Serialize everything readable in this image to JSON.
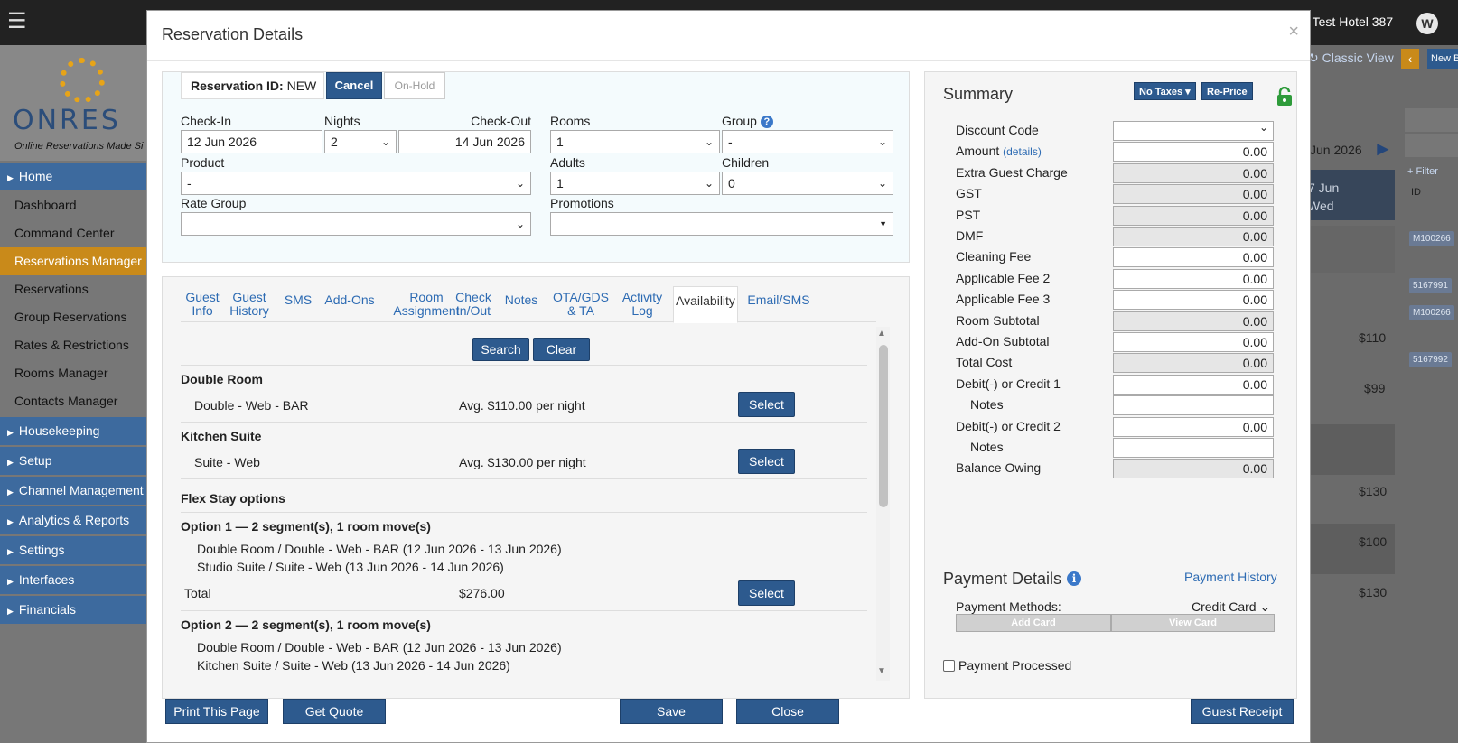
{
  "app": {
    "hotel_name": "s Test Hotel 387",
    "user_initial": "W",
    "logo_text": "ONRES",
    "logo_tagline": "Online Reservations Made Si",
    "menu_glyph": "☰"
  },
  "sidebar": {
    "items": [
      {
        "label": "Home",
        "kind": "section"
      },
      {
        "label": "Dashboard",
        "kind": "link"
      },
      {
        "label": "Command Center",
        "kind": "link"
      },
      {
        "label": "Reservations Manager",
        "kind": "active"
      },
      {
        "label": "Reservations",
        "kind": "link"
      },
      {
        "label": "Group Reservations",
        "kind": "link"
      },
      {
        "label": "Rates & Restrictions",
        "kind": "link"
      },
      {
        "label": "Rooms Manager",
        "kind": "link"
      },
      {
        "label": "Contacts Manager",
        "kind": "link"
      },
      {
        "label": "Housekeeping",
        "kind": "section"
      },
      {
        "label": "Setup",
        "kind": "section"
      },
      {
        "label": "Channel Management",
        "kind": "section"
      },
      {
        "label": "Analytics & Reports",
        "kind": "section"
      },
      {
        "label": "Settings",
        "kind": "section"
      },
      {
        "label": "Interfaces",
        "kind": "section"
      },
      {
        "label": "Financials",
        "kind": "section"
      }
    ]
  },
  "background": {
    "classic_view": "Classic View",
    "new_btn": "New B",
    "date_label": "Jun 2026",
    "day_label": "7 Jun",
    "weekday": "Wed",
    "filter": "Filter",
    "id_col": "ID",
    "tags": [
      "M100266",
      "5167991",
      "M100266",
      "5167992"
    ],
    "prices": [
      "$110",
      "$99",
      "$130",
      "$100",
      "$130"
    ]
  },
  "modal": {
    "title": "Reservation Details",
    "close_glyph": "×",
    "reservation_id_label": "Reservation ID:",
    "reservation_id_value": "NEW",
    "cancel_label": "Cancel",
    "onhold_label": "On-Hold",
    "form": {
      "checkin_label": "Check-In",
      "checkin_value": "12 Jun 2026",
      "nights_label": "Nights",
      "nights_value": "2",
      "checkout_label": "Check-Out",
      "checkout_value": "14 Jun 2026",
      "rooms_label": "Rooms",
      "rooms_value": "1",
      "group_label": "Group",
      "group_value": "-",
      "product_label": "Product",
      "product_value": "-",
      "adults_label": "Adults",
      "adults_value": "1",
      "children_label": "Children",
      "children_value": "0",
      "rate_group_label": "Rate Group",
      "rate_group_value": "",
      "promotions_label": "Promotions",
      "promotions_value": ""
    },
    "tabs": [
      {
        "line1": "Guest",
        "line2": "Info"
      },
      {
        "line1": "Guest",
        "line2": "History"
      },
      {
        "line1": "SMS",
        "line2": ""
      },
      {
        "line1": "Add-Ons",
        "line2": ""
      },
      {
        "line1": "Room",
        "line2": "Assignment"
      },
      {
        "line1": "Check",
        "line2": "In/Out"
      },
      {
        "line1": "Notes",
        "line2": ""
      },
      {
        "line1": "OTA/GDS",
        "line2": "& TA"
      },
      {
        "line1": "Activity",
        "line2": "Log"
      },
      {
        "line1": "Availability",
        "line2": ""
      },
      {
        "line1": "Email/SMS",
        "line2": ""
      }
    ],
    "availability": {
      "search_label": "Search",
      "clear_label": "Clear",
      "select_label": "Select",
      "rooms": [
        {
          "title": "Double Room",
          "rate": "Double - Web - BAR",
          "price": "Avg. $110.00 per night"
        },
        {
          "title": "Kitchen Suite",
          "rate": "Suite - Web",
          "price": "Avg. $130.00 per night"
        }
      ],
      "flex_title": "Flex Stay options",
      "options": [
        {
          "title": "Option 1 — 2 segment(s), 1 room move(s)",
          "segments": [
            "Double Room / Double - Web - BAR (12 Jun 2026 - 13 Jun 2026)",
            "Studio Suite / Suite - Web (13 Jun 2026 - 14 Jun 2026)"
          ],
          "total_label": "Total",
          "total_value": "$276.00"
        },
        {
          "title": "Option 2 — 2 segment(s), 1 room move(s)",
          "segments": [
            "Double Room / Double - Web - BAR (12 Jun 2026 - 13 Jun 2026)",
            "Kitchen Suite / Suite - Web (13 Jun 2026 - 14 Jun 2026)"
          ]
        }
      ]
    },
    "summary": {
      "title": "Summary",
      "no_taxes_label": "No Taxes",
      "reprice_label": "Re-Price",
      "rows": [
        {
          "label": "Discount Code",
          "value": "",
          "readonly": false
        },
        {
          "label": "Amount",
          "value": "0.00",
          "readonly": false,
          "link": "(details)"
        },
        {
          "label": "Extra Guest Charge",
          "value": "0.00",
          "readonly": true
        },
        {
          "label": "GST",
          "value": "0.00",
          "readonly": true
        },
        {
          "label": "PST",
          "value": "0.00",
          "readonly": true
        },
        {
          "label": "DMF",
          "value": "0.00",
          "readonly": true
        },
        {
          "label": "Cleaning Fee",
          "value": "0.00",
          "readonly": false
        },
        {
          "label": "Applicable Fee 2",
          "value": "0.00",
          "readonly": false
        },
        {
          "label": "Applicable Fee 3",
          "value": "0.00",
          "readonly": false
        },
        {
          "label": "Room Subtotal",
          "value": "0.00",
          "readonly": true
        },
        {
          "label": "Add-On Subtotal",
          "value": "0.00",
          "readonly": false
        },
        {
          "label": "Total Cost",
          "value": "0.00",
          "readonly": true
        },
        {
          "label": "Debit(-) or Credit 1",
          "value": "0.00",
          "readonly": false
        },
        {
          "label": "Notes",
          "value": "",
          "readonly": false,
          "indent": true
        },
        {
          "label": "Debit(-) or Credit 2",
          "value": "0.00",
          "readonly": false
        },
        {
          "label": "Notes",
          "value": "",
          "readonly": false,
          "indent": true
        },
        {
          "label": "Balance Owing",
          "value": "0.00",
          "readonly": true
        }
      ]
    },
    "payment": {
      "title": "Payment Details",
      "history_link": "Payment History",
      "methods_label": "Payment Methods:",
      "methods_value": "Credit Card",
      "add_card": "Add Card",
      "view_card": "View Card",
      "processed_label": "Payment Processed"
    },
    "footer": {
      "print": "Print This Page",
      "quote": "Get Quote",
      "save": "Save",
      "close": "Close",
      "receipt": "Guest Receipt"
    }
  },
  "colors": {
    "primary": "#2d5a8e",
    "link": "#2d6bb3",
    "accent_orange": "#c98a1a",
    "lock_green": "#2e9b3a"
  }
}
